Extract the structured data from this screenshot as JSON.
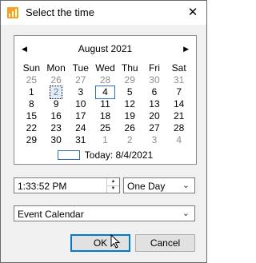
{
  "window": {
    "title": "Select the time",
    "close_glyph": "✕",
    "app_icon": "chart-bars-icon"
  },
  "calendar": {
    "month_label": "August 2021",
    "prev_glyph": "◀",
    "next_glyph": "▶",
    "weekdays": [
      "Sun",
      "Mon",
      "Tue",
      "Wed",
      "Thu",
      "Fri",
      "Sat"
    ],
    "weeks": [
      [
        {
          "d": "25",
          "muted": true
        },
        {
          "d": "26",
          "muted": true
        },
        {
          "d": "27",
          "muted": true
        },
        {
          "d": "28",
          "muted": true
        },
        {
          "d": "29",
          "muted": true
        },
        {
          "d": "30",
          "muted": true
        },
        {
          "d": "31",
          "muted": true
        }
      ],
      [
        {
          "d": "1"
        },
        {
          "d": "2",
          "selected": true
        },
        {
          "d": "3"
        },
        {
          "d": "4",
          "today": true
        },
        {
          "d": "5"
        },
        {
          "d": "6"
        },
        {
          "d": "7"
        }
      ],
      [
        {
          "d": "8"
        },
        {
          "d": "9"
        },
        {
          "d": "10"
        },
        {
          "d": "11"
        },
        {
          "d": "12"
        },
        {
          "d": "13"
        },
        {
          "d": "14"
        }
      ],
      [
        {
          "d": "15"
        },
        {
          "d": "16"
        },
        {
          "d": "17"
        },
        {
          "d": "18"
        },
        {
          "d": "19"
        },
        {
          "d": "20"
        },
        {
          "d": "21"
        }
      ],
      [
        {
          "d": "22"
        },
        {
          "d": "23"
        },
        {
          "d": "24"
        },
        {
          "d": "25"
        },
        {
          "d": "26"
        },
        {
          "d": "27"
        },
        {
          "d": "28"
        }
      ],
      [
        {
          "d": "29"
        },
        {
          "d": "30"
        },
        {
          "d": "31"
        },
        {
          "d": "1",
          "muted": true
        },
        {
          "d": "2",
          "muted": true
        },
        {
          "d": "3",
          "muted": true
        },
        {
          "d": "4",
          "muted": true
        }
      ]
    ],
    "today_label": "Today: 8/4/2021"
  },
  "time": {
    "value": "1:33:52 PM",
    "spin_up_glyph": "▲",
    "spin_down_glyph": "▼"
  },
  "period": {
    "value": "One Day",
    "chevron_glyph": "⌄"
  },
  "calendar_source": {
    "value": "Event Calendar",
    "chevron_glyph": "⌄"
  },
  "buttons": {
    "ok": "OK",
    "cancel": "Cancel"
  },
  "colors": {
    "accent": "#0078d7",
    "today_border": "#2a6ebb",
    "app_icon": "#f6a21a"
  }
}
